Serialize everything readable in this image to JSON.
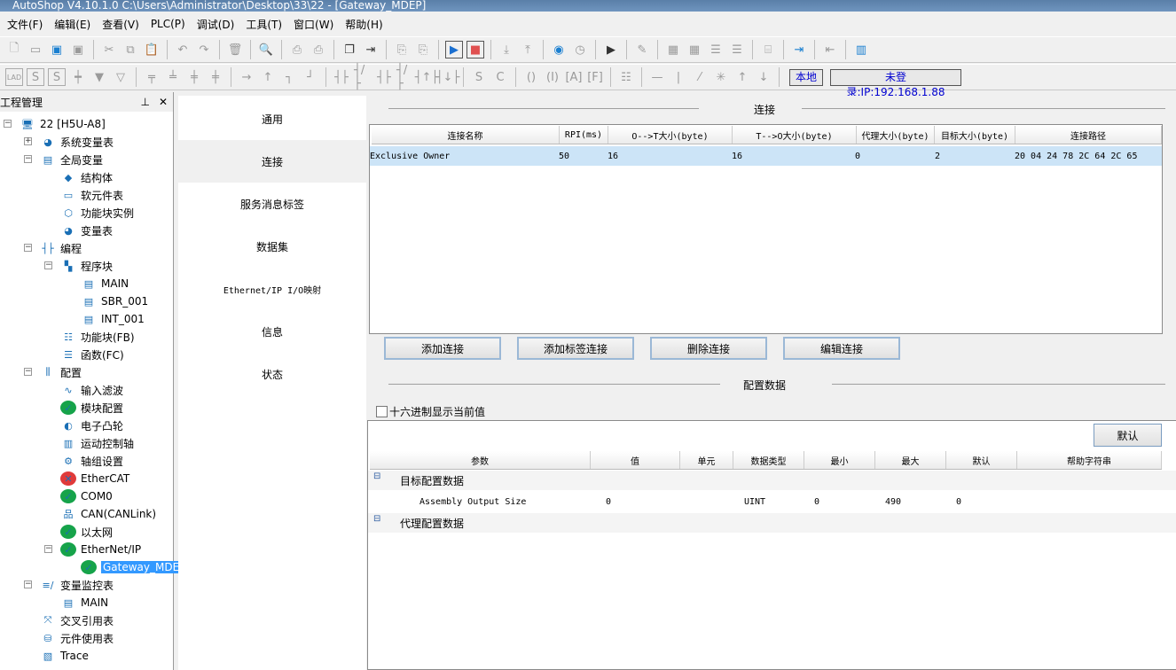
{
  "window": {
    "title": "AutoShop V4.10.1.0  C:\\Users\\Administrator\\Desktop\\33\\22 - [Gateway_MDEP]"
  },
  "menu": [
    "文件(F)",
    "编辑(E)",
    "查看(V)",
    "PLC(P)",
    "调试(D)",
    "工具(T)",
    "窗口(W)",
    "帮助(H)"
  ],
  "status": {
    "mode": "本地",
    "login": "未登录:IP:192.168.1.88"
  },
  "project": {
    "title": "工程管理",
    "pin": "ᵖ",
    "close": "✕",
    "tree": [
      {
        "label": "22 [H5U-A8]",
        "icon": "monitor-icon"
      },
      {
        "label": "系统变量表",
        "icon": "globe-icon"
      },
      {
        "label": "全局变量",
        "icon": "document-icon"
      },
      {
        "label": "结构体",
        "icon": "struct-icon"
      },
      {
        "label": "软元件表",
        "icon": "comment-icon"
      },
      {
        "label": "功能块实例",
        "icon": "cube-icon"
      },
      {
        "label": "变量表",
        "icon": "globe-icon"
      },
      {
        "label": "编程",
        "icon": "ladder-icon"
      },
      {
        "label": "程序块",
        "icon": "blocks-icon"
      },
      {
        "label": "MAIN",
        "icon": "program-icon"
      },
      {
        "label": "SBR_001",
        "icon": "program-icon"
      },
      {
        "label": "INT_001",
        "icon": "program-icon"
      },
      {
        "label": "功能块(FB)",
        "icon": "fb-icon"
      },
      {
        "label": "函数(FC)",
        "icon": "fc-icon"
      },
      {
        "label": "配置",
        "icon": "config-icon"
      },
      {
        "label": "输入滤波",
        "icon": "wave-icon"
      },
      {
        "label": "模块配置",
        "icon": "check-icon"
      },
      {
        "label": "电子凸轮",
        "icon": "cam-icon"
      },
      {
        "label": "运动控制轴",
        "icon": "axis-icon"
      },
      {
        "label": "轴组设置",
        "icon": "gear-icon"
      },
      {
        "label": "EtherCAT",
        "icon": "error-icon"
      },
      {
        "label": "COM0",
        "icon": "check-icon"
      },
      {
        "label": "CAN(CANLink)",
        "icon": "network-icon"
      },
      {
        "label": "以太网",
        "icon": "check-icon"
      },
      {
        "label": "EtherNet/IP",
        "icon": "check-icon"
      },
      {
        "label": "Gateway_MDEP",
        "icon": "check-icon"
      },
      {
        "label": "变量监控表",
        "icon": "monitor-chart-icon"
      },
      {
        "label": "MAIN",
        "icon": "table-icon"
      },
      {
        "label": "交叉引用表",
        "icon": "cross-icon"
      },
      {
        "label": "元件使用表",
        "icon": "database-icon"
      },
      {
        "label": "Trace",
        "icon": "trace-icon"
      }
    ]
  },
  "nav": [
    "通用",
    "连接",
    "服务消息标签",
    "数据集",
    "Ethernet/IP I/O映射",
    "信息",
    "状态"
  ],
  "connection": {
    "section": "连接",
    "columns": [
      "连接名称",
      "RPI(ms)",
      "O-->T大小(byte)",
      "T-->O大小(byte)",
      "代理大小(byte)",
      "目标大小(byte)",
      "连接路径"
    ],
    "rows": [
      [
        "Exclusive Owner",
        "50",
        "16",
        "16",
        "0",
        "2",
        "20 04 24 78 2C 64 2C 65"
      ]
    ],
    "buttons": [
      "添加连接",
      "添加标签连接",
      "删除连接",
      "编辑连接"
    ]
  },
  "config": {
    "section": "配置数据",
    "hex_checkbox": "十六进制显示当前值",
    "hex_checked": false,
    "default_button": "默认",
    "columns": [
      "参数",
      "值",
      "单元",
      "数据类型",
      "最小",
      "最大",
      "默认",
      "帮助字符串"
    ],
    "groups": [
      {
        "label": "目标配置数据",
        "rows": [
          [
            "Assembly Output Size",
            "0",
            "",
            "UINT",
            "0",
            "490",
            "0",
            ""
          ]
        ]
      },
      {
        "label": "代理配置数据",
        "rows": []
      }
    ]
  }
}
